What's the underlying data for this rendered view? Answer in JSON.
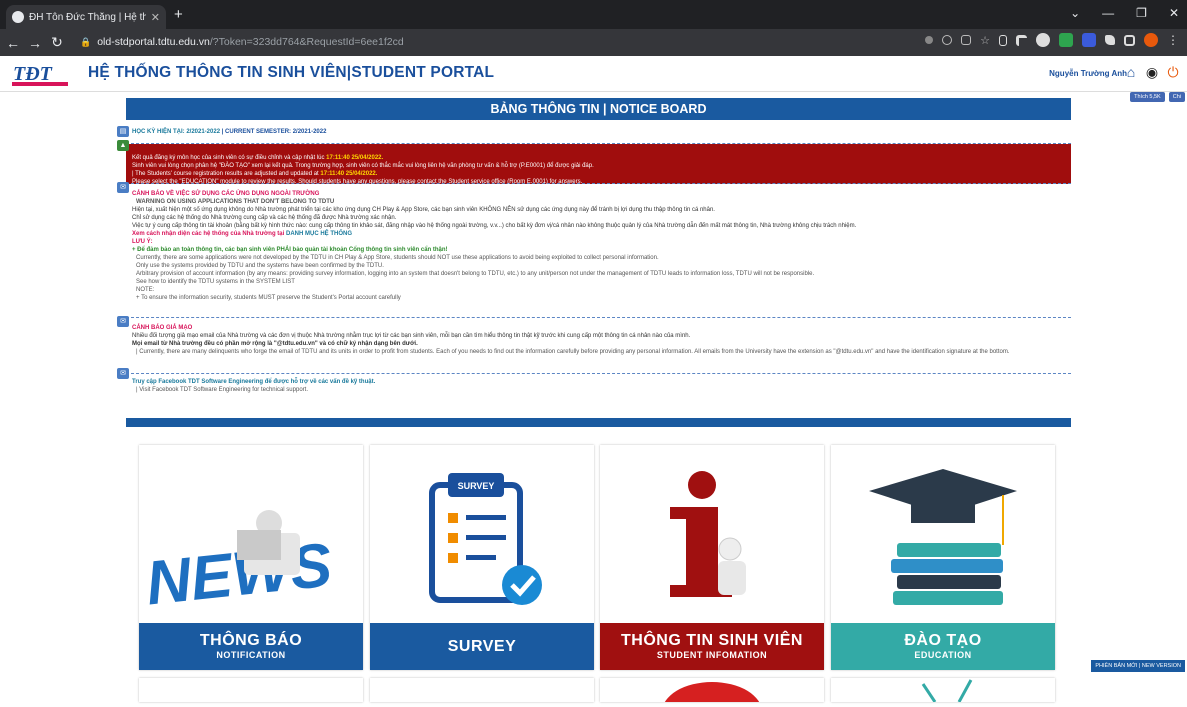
{
  "browser": {
    "tab_title": "ĐH Tôn Đức Thắng | Hệ thống th",
    "url_host": "old-stdportal.tdtu.edu.vn",
    "url_rest": "/?Token=323dd764&RequestId=6ee1f2cd"
  },
  "header": {
    "title": "HỆ THỐNG THÔNG TIN SINH VIÊN|STUDENT PORTAL",
    "user_name": "Nguyễn Trường Anh"
  },
  "fb": {
    "like": "Thích 5,5K",
    "share": "Chi"
  },
  "notice": {
    "heading": "BẢNG THÔNG TIN | NOTICE BOARD",
    "semester_vi": "HỌC KỲ HIỆN TẠI: 2/2021-2022",
    "semester_en": "| CURRENT SEMESTER: 2/2021-2022",
    "red_l1a": "Kết quả đăng ký môn học của sinh viên có sự điều chỉnh và cập nhật lúc",
    "red_time": "17:11:40 25/04/2022.",
    "red_l2": "Sinh viên vui lòng chọn phân hệ \"ĐÀO TẠO\" xem lại kết quả. Trong trường hợp, sinh viên có thắc mắc vui lòng liên hệ văn phòng tư vấn & hỗ trợ (P.E0001) để được giải đáp.",
    "red_l3a": "| The Students' course registration results are adjusted and updated at",
    "red_l4": "Please select the \"EDUCATION\" module to review the results. Should students have any questions, please contact the Student service office (Room E.0001) for answers.",
    "warn_title": "CẢNH BÁO VỀ VIỆC SỬ DỤNG CÁC ỨNG DỤNG NGOÀI TRƯỜNG",
    "warn_title_en": "WARNING ON USING APPLICATIONS THAT DON'T BELONG TO TDTU",
    "warn_l1": "Hiện tại, xuất hiện một số ứng dụng không do Nhà trường phát triển tại các kho ứng dụng CH Play & App Store, các bạn sinh viên KHÔNG NÊN sử dụng các ứng dụng này để tránh bị lợi dụng thu thập thông tin cá nhân.",
    "warn_l2": "Chỉ sử dụng các hệ thống do Nhà trường cung cấp và các hệ thống đã được Nhà trường xác nhận.",
    "warn_l3": "Việc tự ý cung cấp thông tin tài khoản (bằng bất kỳ hình thức nào: cung cấp thông tin khảo sát, đăng nhập vào hệ thống ngoài trường, v.v...) cho bất kỳ đơn vị/cá nhân nào không thuộc quản lý của Nhà trường dẫn đến mất mát thông tin, Nhà trường không chịu trách nhiệm.",
    "warn_l4": "Xem cách nhận diện các hệ thống của Nhà trường tại",
    "warn_l4_link": "DANH MỤC HỆ THỐNG",
    "warn_note": "LƯU Ý:",
    "warn_l5": "+ Để đảm bảo an toàn thông tin, các bạn sinh viên PHẢI bảo quản tài khoản Cổng thông tin sinh viên cẩn thận!",
    "warn_e1": "Currently, there are some applications were not developed by the TDTU in CH Play & App Store, students should NOT use these applications to avoid being exploited to collect personal information.",
    "warn_e2": "Only use the systems provided by TDTU and the systems have been confirmed by the TDTU.",
    "warn_e3": "Arbitrary provision of account information (by any means: providing survey information, logging into an system that doesn't belong to TDTU, etc.) to any unit/person not under the management of TDTU leads to information loss, TDTU will not be responsible.",
    "warn_e4": "See how to identify the TDTU systems in the SYSTEM LIST",
    "warn_e5": "NOTE:",
    "warn_e6": "+ To ensure the information security, students MUST preserve the Student's Portal account carefully",
    "fake_title": "CẢNH BÁO GIẢ MẠO",
    "fake_l1": "Nhiều đối tượng giả mạo email của Nhà trường và các đơn vị thuộc Nhà trường nhằm trục lợi từ các bạn sinh viên, mỗi bạn cần tìm hiểu thông tin thật kỹ trước khi cung cấp một thông tin cá nhân nào của mình.",
    "fake_l2": "Mọi email từ Nhà trường đều có phần mở rộng là \"@tdtu.edu.vn\" và có chữ ký nhận dạng bên dưới.",
    "fake_l3": "| Currently, there are many delinquents who forge the email of TDTU and its units in order to profit from students. Each of you needs to find out the information carefully before providing any personal information. All emails from the University have the extension as \"@tdtu.edu.vn\" and have the identification signature at the bottom.",
    "fb_title": "Truy cập Facebook TDT Software Engineering để được hỗ trợ về các vấn đề kỹ thuật.",
    "fb_l1": "| Visit Facebook TDT Software Engineering for technical support."
  },
  "tiles": [
    {
      "big": "THÔNG BÁO",
      "small": "NOTIFICATION",
      "color": "#1a5aa0"
    },
    {
      "big": "SURVEY",
      "small": "",
      "color": "#1a5aa0"
    },
    {
      "big": "THÔNG TIN SINH VIÊN",
      "small": "STUDENT INFOMATION",
      "color": "#a01010"
    },
    {
      "big": "ĐÀO TẠO",
      "small": "EDUCATION",
      "color": "#33aaa6"
    }
  ],
  "survey_badge": "SURVEY",
  "new_version": "PHIÊN BẢN MỚI | NEW VERSION"
}
